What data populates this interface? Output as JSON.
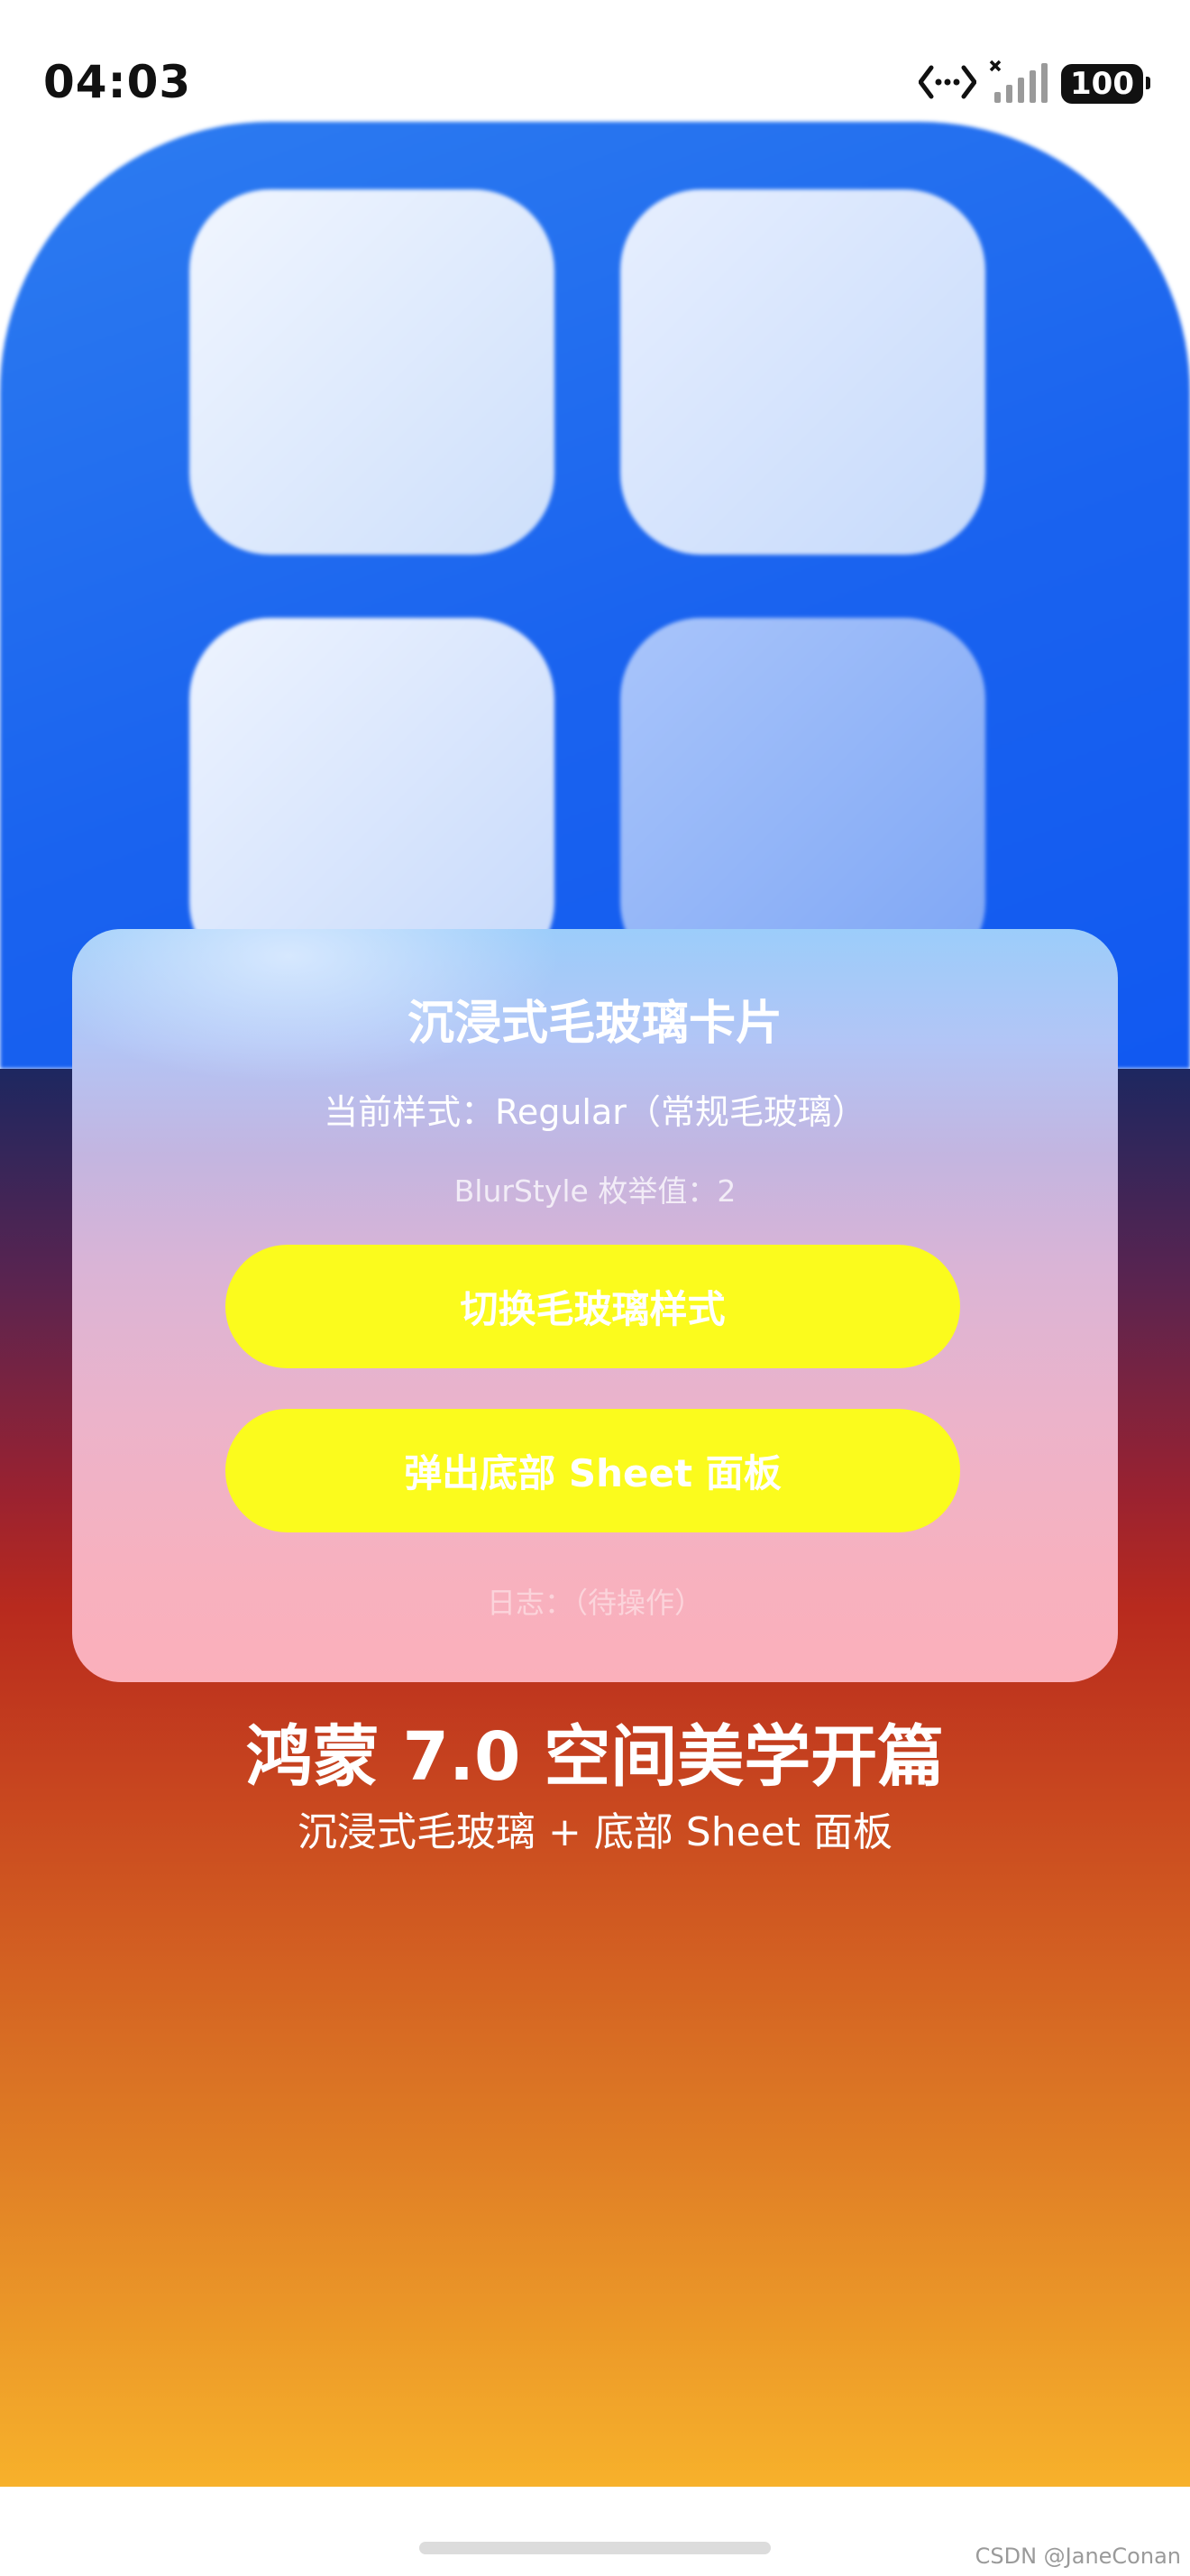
{
  "status_bar": {
    "time": "04:03",
    "battery": "100",
    "icons": [
      "data-transfer-icon",
      "signal-icon",
      "battery-icon"
    ]
  },
  "card": {
    "title": "沉浸式毛玻璃卡片",
    "style_text": "当前样式：Regular（常规毛玻璃）",
    "enum_text": "BlurStyle 枚举值：2",
    "switch_button": "切换毛玻璃样式",
    "sheet_button": "弹出底部 Sheet 面板",
    "log_text": "日志：（待操作）"
  },
  "headline": {
    "title": "鸿蒙 7.0 空间美学开篇",
    "subtitle": "沉浸式毛玻璃 + 底部 Sheet 面板"
  },
  "watermark": "CSDN @JaneConan",
  "colors": {
    "button_bg": "#fbfb1d",
    "icon_blue": "#1a63ef",
    "gradient_top": "#1d2760",
    "gradient_mid": "#b82a1e",
    "gradient_bottom": "#f7b12b"
  }
}
